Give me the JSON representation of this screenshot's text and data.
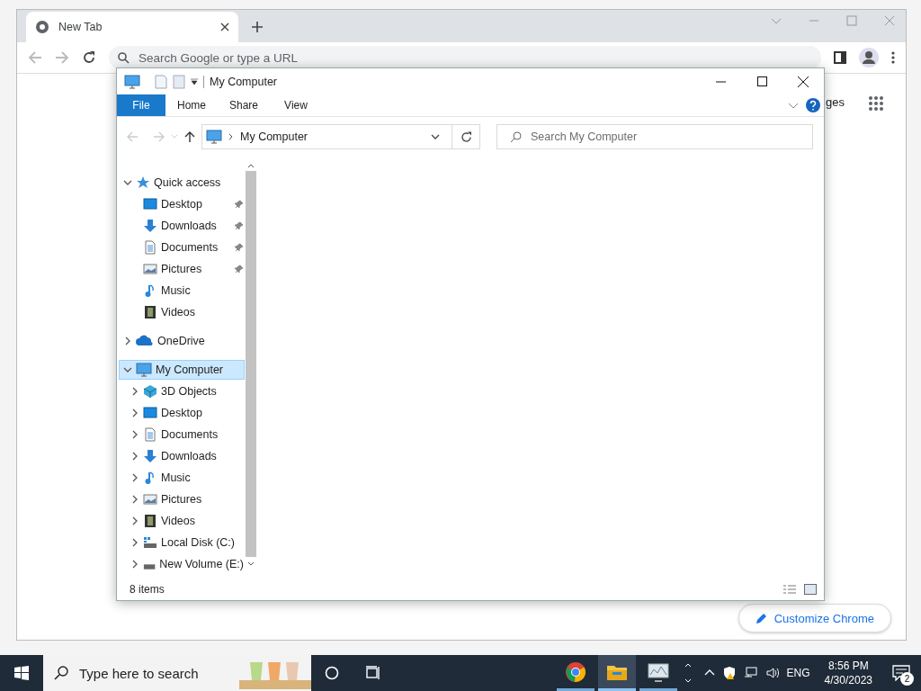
{
  "browser": {
    "tab": {
      "title": "New Tab"
    },
    "address": {
      "placeholder": "Search Google or type a URL"
    },
    "images_link": "ges",
    "customize_button": "Customize Chrome"
  },
  "explorer": {
    "title": "My Computer",
    "ribbon_tabs": [
      {
        "label": "File",
        "selected": true
      },
      {
        "label": "Home",
        "selected": false
      },
      {
        "label": "Share",
        "selected": false
      },
      {
        "label": "View",
        "selected": false
      }
    ],
    "address": "My Computer",
    "search": {
      "placeholder": "Search My Computer"
    },
    "tree": [
      {
        "label": "Quick access",
        "kind": "star",
        "expanded": true,
        "selected": false,
        "children": [
          {
            "label": "Desktop",
            "kind": "desktop",
            "pinned": true,
            "selected": false
          },
          {
            "label": "Downloads",
            "kind": "download",
            "pinned": true,
            "selected": false
          },
          {
            "label": "Documents",
            "kind": "document",
            "pinned": true,
            "selected": false
          },
          {
            "label": "Pictures",
            "kind": "pictures",
            "pinned": true,
            "selected": false
          },
          {
            "label": "Music",
            "kind": "music",
            "pinned": false,
            "selected": false
          },
          {
            "label": "Videos",
            "kind": "video",
            "pinned": false,
            "selected": false
          }
        ]
      },
      {
        "label": "OneDrive",
        "kind": "cloud",
        "expanded": false,
        "selected": false
      },
      {
        "label": "My Computer",
        "kind": "computer",
        "expanded": true,
        "selected": true,
        "children": [
          {
            "label": "3D Objects",
            "kind": "cube",
            "expanded": false,
            "selected": false
          },
          {
            "label": "Desktop",
            "kind": "desktop",
            "expanded": false,
            "selected": false
          },
          {
            "label": "Documents",
            "kind": "document",
            "expanded": false,
            "selected": false
          },
          {
            "label": "Downloads",
            "kind": "download",
            "expanded": false,
            "selected": false
          },
          {
            "label": "Music",
            "kind": "music",
            "expanded": false,
            "selected": false
          },
          {
            "label": "Pictures",
            "kind": "pictures",
            "expanded": false,
            "selected": false
          },
          {
            "label": "Videos",
            "kind": "video",
            "expanded": false,
            "selected": false
          },
          {
            "label": "Local Disk (C:)",
            "kind": "disk",
            "expanded": false,
            "selected": false
          },
          {
            "label": "New Volume (E:)",
            "kind": "drive",
            "expanded": false,
            "selected": false
          }
        ]
      }
    ],
    "status": "8 items"
  },
  "taskbar": {
    "search": {
      "placeholder": "Type here to search"
    },
    "apps": [
      {
        "kind": "chrome",
        "selected": false
      },
      {
        "kind": "folder",
        "selected": true
      },
      {
        "kind": "monitor",
        "selected": false
      }
    ],
    "language": "ENG",
    "time": "8:56 PM",
    "date": "4/30/2023",
    "notifications": "2"
  }
}
